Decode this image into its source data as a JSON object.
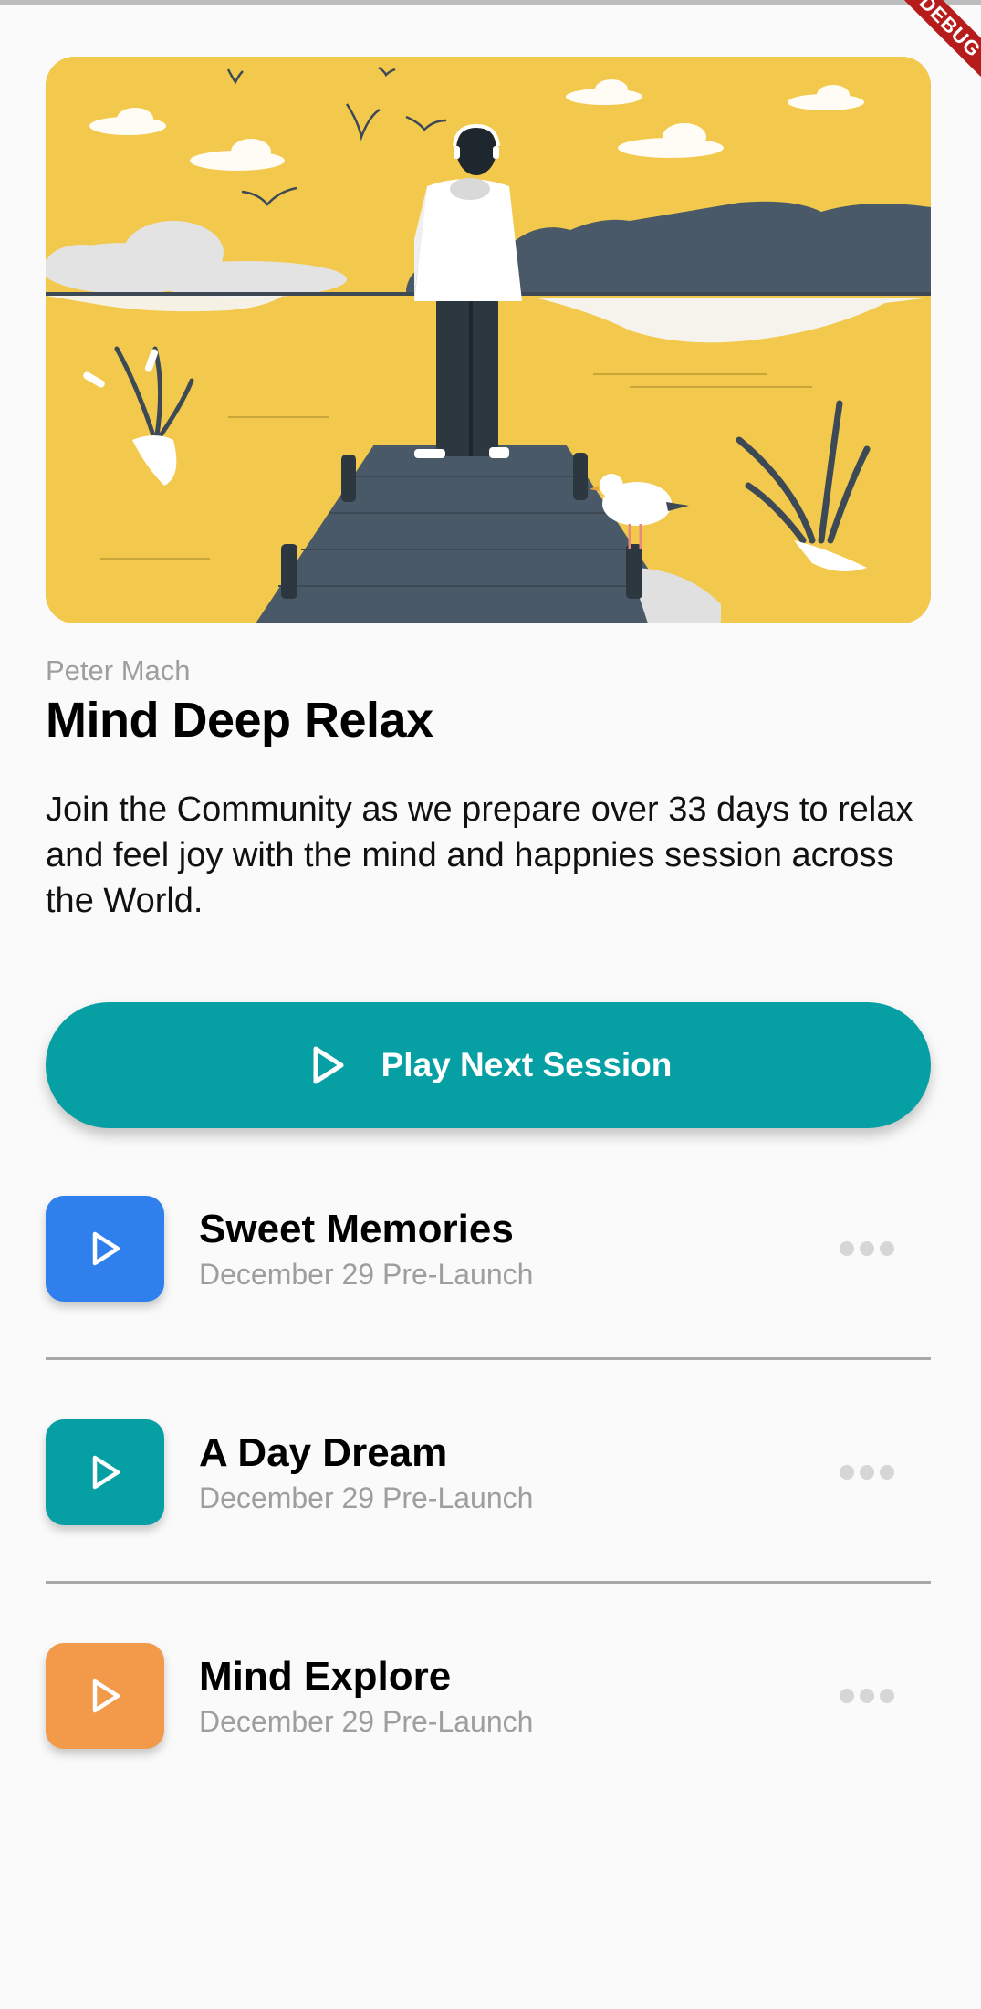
{
  "debug_banner": {
    "label": "DEBUG"
  },
  "hero": {
    "illustration": "man-on-pier-illustration",
    "bg_color": "#f2c94c"
  },
  "header": {
    "author": "Peter Mach",
    "title": "Mind Deep Relax",
    "description": "Join the Community as we prepare over 33 days to relax and feel joy with the mind and happnies session across the World."
  },
  "play_button": {
    "label": "Play Next Session",
    "icon": "play-icon",
    "color": "#069fa4"
  },
  "sessions": [
    {
      "title": "Sweet Memories",
      "subtitle": "December 29 Pre-Launch",
      "color": "#2f80ed",
      "icon": "play-icon"
    },
    {
      "title": "A Day Dream",
      "subtitle": "December 29 Pre-Launch",
      "color": "#069fa4",
      "icon": "play-icon"
    },
    {
      "title": "Mind Explore",
      "subtitle": "December 29 Pre-Launch",
      "color": "#f2994a",
      "icon": "play-icon"
    }
  ]
}
